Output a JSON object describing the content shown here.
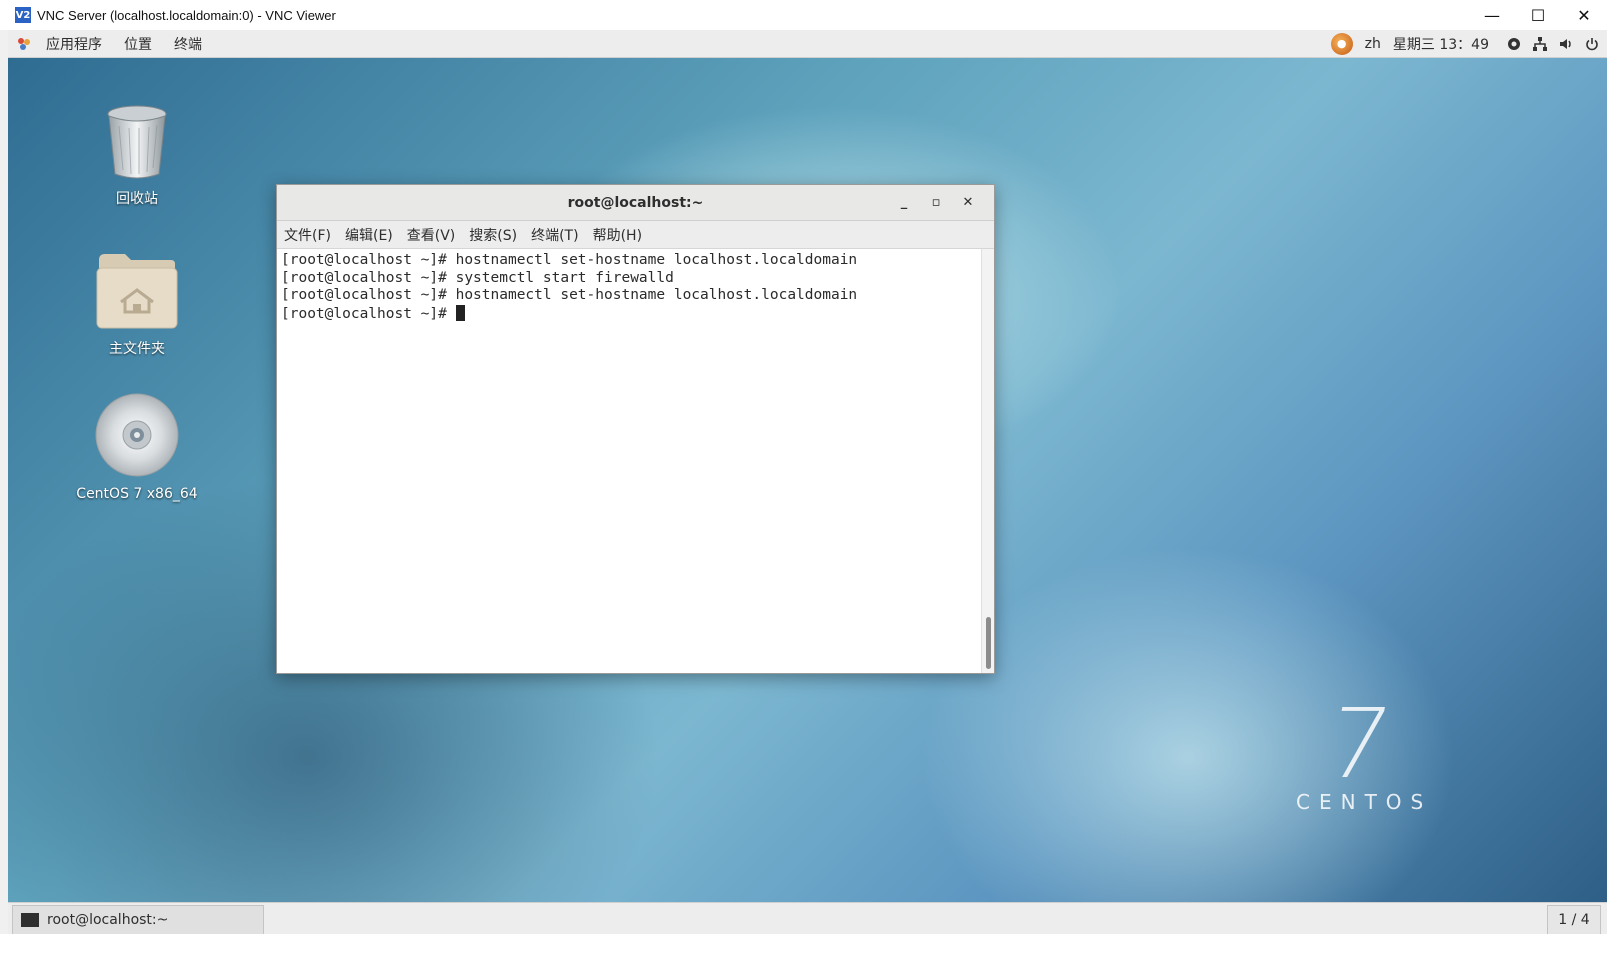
{
  "vnc_window": {
    "logo": "V2",
    "title": "VNC Server (localhost.localdomain:0) - VNC Viewer",
    "controls": {
      "minimize": "—",
      "maximize": "☐",
      "close": "✕"
    }
  },
  "top_panel": {
    "menus": [
      "应用程序",
      "位置",
      "终端"
    ],
    "ime": "●",
    "language": "zh",
    "clock": "星期三 13：49"
  },
  "desktop": {
    "icons": [
      {
        "label": "回收站",
        "icon": "trash-icon"
      },
      {
        "label": "主文件夹",
        "icon": "home-folder-icon"
      },
      {
        "label": "CentOS 7 x86_64",
        "icon": "optical-disc-icon"
      }
    ],
    "brand": {
      "number": "7",
      "name": "CENTOS"
    }
  },
  "terminal": {
    "title": "root@localhost:~",
    "controls": {
      "minimize": "_",
      "maximize": "▫",
      "close": "✕"
    },
    "menus": [
      "文件(F)",
      "编辑(E)",
      "查看(V)",
      "搜索(S)",
      "终端(T)",
      "帮助(H)"
    ],
    "lines": [
      "[root@localhost ~]# hostnamectl set-hostname localhost.localdomain",
      "[root@localhost ~]# systemctl start firewalld",
      "[root@localhost ~]# hostnamectl set-hostname localhost.localdomain",
      "[root@localhost ~]# "
    ]
  },
  "taskbar": {
    "task_label": "root@localhost:~",
    "workspace": "1 / 4"
  }
}
